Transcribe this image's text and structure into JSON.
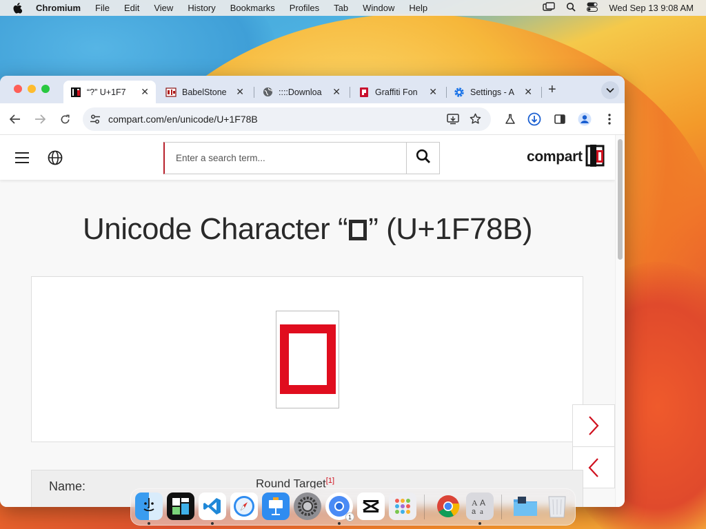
{
  "menubar": {
    "app": "Chromium",
    "items": [
      "File",
      "Edit",
      "View",
      "History",
      "Bookmarks",
      "Profiles",
      "Tab",
      "Window",
      "Help"
    ],
    "clock": "Wed Sep 13  9:08 AM"
  },
  "tabs": [
    {
      "title": "“?” U+1F7",
      "favicon": "compart-logo-icon",
      "active": true
    },
    {
      "title": "BabelStone",
      "favicon": "babelstone-icon",
      "active": false
    },
    {
      "title": "::::Downloa",
      "favicon": "globe-icon",
      "active": false
    },
    {
      "title": "Graffiti Fon",
      "favicon": "graffiti-icon",
      "active": false
    },
    {
      "title": "Settings - A",
      "favicon": "gear-icon",
      "active": false
    }
  ],
  "toolbar": {
    "url": "compart.com/en/unicode/U+1F78B"
  },
  "site": {
    "search_placeholder": "Enter a search term...",
    "logo_text": "compart",
    "page_title_prefix": "Unicode Character “",
    "page_title_suffix": "” (U+1F78B)",
    "glyph_color": "#e00d1e",
    "info": {
      "label": "Name:",
      "value": "Round Target",
      "footnote": "[1]"
    }
  },
  "dock": {
    "apps": [
      "Finder",
      "Mosaic",
      "Visual Studio Code",
      "Safari",
      "Keynote",
      "System Settings",
      "Chromium",
      "CapCut",
      "Launchpad",
      "Google Chrome",
      "Font Book",
      "Downloads",
      "Trash"
    ],
    "chromium_badge": "1"
  },
  "colors": {
    "accent_red": "#b8202b",
    "tabbar_bg": "#dfe6f3"
  }
}
